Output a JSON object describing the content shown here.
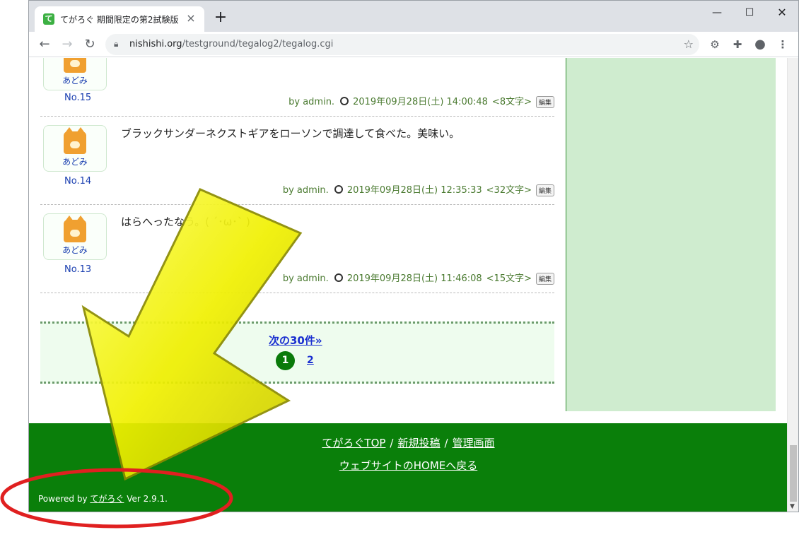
{
  "browser": {
    "tab_title": "てがろぐ 期間限定の第2試験版",
    "favicon_glyph": "て",
    "url_host": "nishishi.org",
    "url_path": "/testground/tegalog2/tegalog.cgi",
    "icons": [
      "back-icon",
      "forward-icon",
      "reload-icon",
      "lock-icon",
      "star-icon",
      "gear-icon",
      "puzzle-icon",
      "profile-icon",
      "menu-icon"
    ]
  },
  "posts": [
    {
      "no": "No.15",
      "avatar_name": "あどみ",
      "body": "",
      "by": "by admin.",
      "datetime": "2019年09月28日(土) 14:00:48",
      "chars": "<8文字>",
      "edit": "編集"
    },
    {
      "no": "No.14",
      "avatar_name": "あどみ",
      "body": "ブラックサンダーネクストギアをローソンで調達して食べた。美味い。",
      "by": "by admin.",
      "datetime": "2019年09月28日(土) 12:35:33",
      "chars": "<32文字>",
      "edit": "編集"
    },
    {
      "no": "No.13",
      "avatar_name": "あどみ",
      "body": "はらへったなう。( ´･ω･` )",
      "by": "by admin.",
      "datetime": "2019年09月28日(土) 11:46:08",
      "chars": "<15文字>",
      "edit": "編集"
    }
  ],
  "pager": {
    "next_label": "次の30件»",
    "current_page": "1",
    "page_2": "2"
  },
  "footer": {
    "link_top": "てがろぐTOP",
    "link_new": "新規投稿",
    "link_admin": "管理画面",
    "sep": "/",
    "link_home": "ウェブサイトのHOMEへ戻る",
    "powered_prefix": "Powered by",
    "powered_link": "てがろぐ",
    "powered_suffix": "Ver 2.9.1."
  },
  "colors": {
    "footer_bg": "#0a7f0a",
    "sidebar_bg": "#cfeccf",
    "arrow": "#f0f000",
    "circle": "#e02020"
  }
}
